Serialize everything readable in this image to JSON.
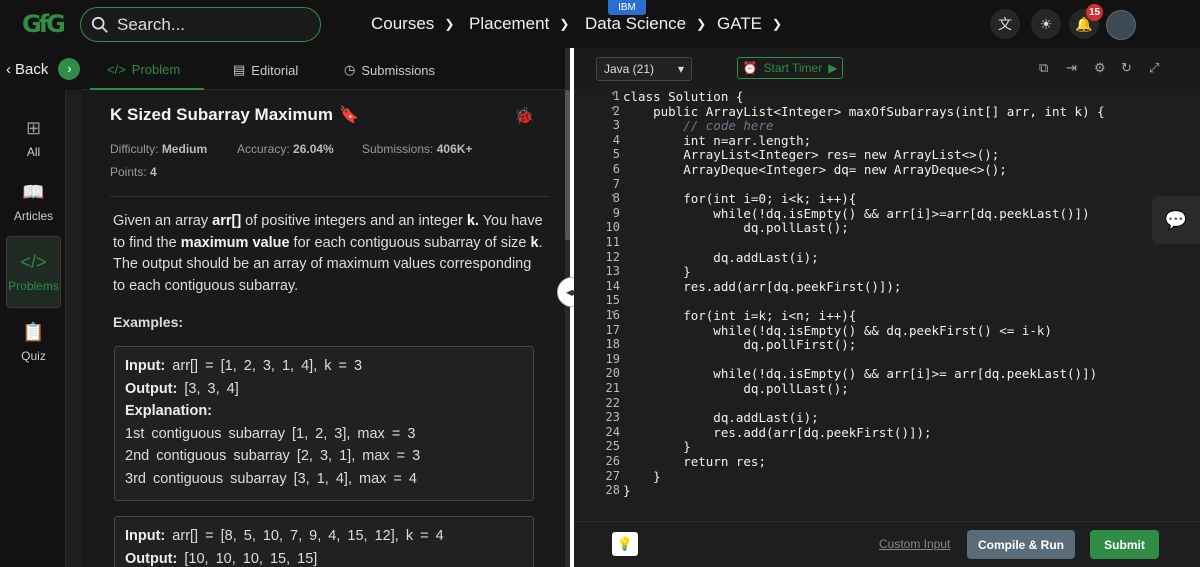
{
  "header": {
    "logo_text": "GfG",
    "search_placeholder": "Search...",
    "nav": [
      {
        "label": "Courses"
      },
      {
        "label": "Placement"
      },
      {
        "label": "Data Science"
      },
      {
        "label": "GATE"
      }
    ],
    "ibm_badge": "IBM",
    "notifications_count": "15",
    "icons": [
      "translate-icon",
      "theme-icon",
      "bell-icon",
      "avatar"
    ]
  },
  "rail": {
    "back_label": "Back",
    "items": [
      {
        "label": "All",
        "icon": "grid-icon"
      },
      {
        "label": "Articles",
        "icon": "book-icon"
      },
      {
        "label": "Problems",
        "icon": "code-icon",
        "active": true
      },
      {
        "label": "Quiz",
        "icon": "clipboard-icon"
      }
    ]
  },
  "problem_tabs": [
    {
      "label": "Problem",
      "icon": "</>"
    },
    {
      "label": "Editorial",
      "icon": "▤"
    },
    {
      "label": "Submissions",
      "icon": "◷"
    }
  ],
  "problem": {
    "title": "K Sized Subarray Maximum",
    "difficulty_label": "Difficulty:",
    "difficulty": "Medium",
    "accuracy_label": "Accuracy:",
    "accuracy": "26.04%",
    "submissions_label": "Submissions:",
    "submissions": "406K+",
    "points_label": "Points:",
    "points": "4",
    "description": {
      "p1": "Given an array ",
      "arr": "arr[]",
      "p2": " of positive integers and an integer ",
      "k": "k.",
      "p3": " You have to find the ",
      "max": "maximum value",
      "p4": " for each contiguous subarray of size ",
      "k2": "k",
      "p5": ". The output should be an array of maximum values corresponding to each contiguous subarray."
    },
    "examples_heading": "Examples:",
    "example1": {
      "input_label": "Input:",
      "input": "arr[] = [1, 2, 3, 1, 4], k = 3",
      "output_label": "Output:",
      "output": "[3, 3, 4]",
      "explanation_label": "Explanation:",
      "lines": [
        "1st contiguous subarray [1, 2, 3], max = 3",
        "2nd contiguous subarray [2, 3, 1], max = 3",
        "3rd contiguous subarray [3, 1, 4], max = 4"
      ]
    },
    "example2": {
      "input_label": "Input:",
      "input": "arr[] = [8, 5, 10, 7, 9, 4, 15, 12], k = 4",
      "output_label": "Output:",
      "output": "[10, 10, 10, 15, 15]"
    }
  },
  "editor": {
    "language": "Java (21)",
    "timer_label": "Start Timer",
    "line_count": 28,
    "code": [
      "class Solution {",
      "    public ArrayList<Integer> maxOfSubarrays(int[] arr, int k) {",
      "        // code here",
      "        int n=arr.length;",
      "        ArrayList<Integer> res= new ArrayList<>();",
      "        ArrayDeque<Integer> dq= new ArrayDeque<>();",
      "",
      "        for(int i=0; i<k; i++){",
      "            while(!dq.isEmpty() && arr[i]>=arr[dq.peekLast()])",
      "                dq.pollLast();",
      "",
      "            dq.addLast(i);",
      "        }",
      "        res.add(arr[dq.peekFirst()]);",
      "",
      "        for(int i=k; i<n; i++){",
      "            while(!dq.isEmpty() && dq.peekFirst() <= i-k)",
      "                dq.pollFirst();",
      "",
      "            while(!dq.isEmpty() && arr[i]>= arr[dq.peekLast()])",
      "                dq.pollLast();",
      "",
      "            dq.addLast(i);",
      "            res.add(arr[dq.peekFirst()]);",
      "        }",
      "        return res;",
      "    }",
      "}"
    ],
    "custom_input_label": "Custom Input",
    "compile_label": "Compile & Run",
    "submit_label": "Submit"
  }
}
